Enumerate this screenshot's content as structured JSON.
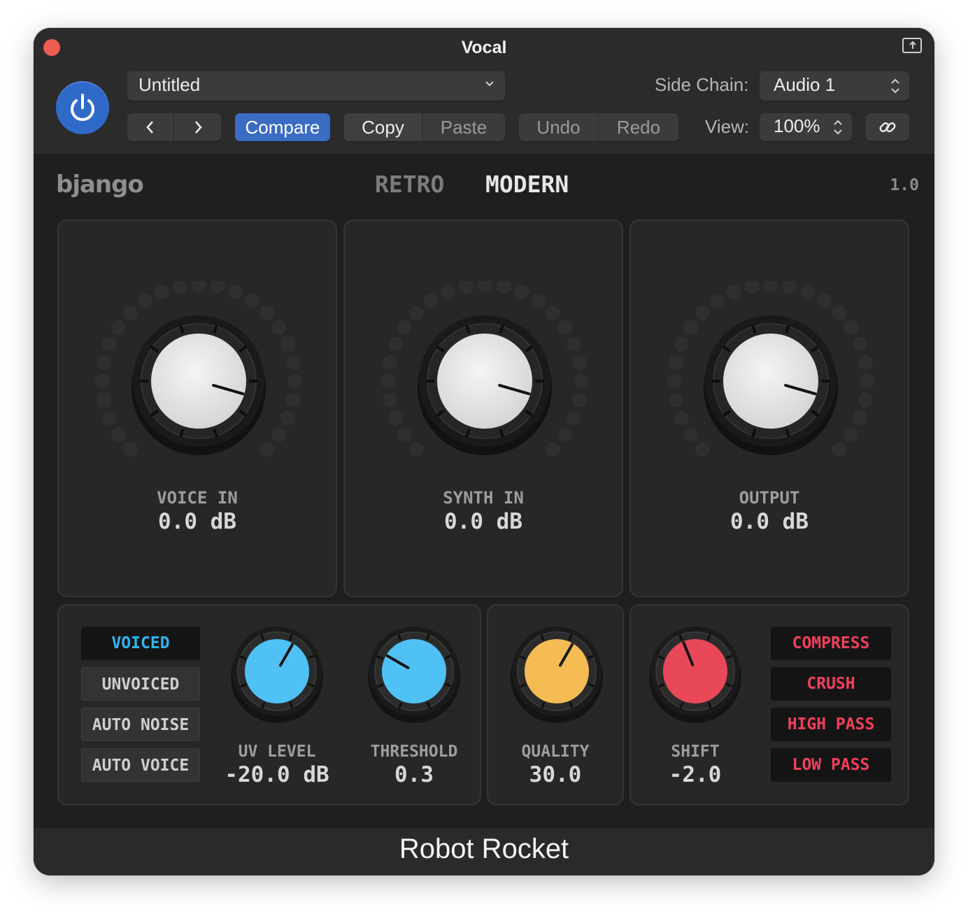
{
  "window": {
    "title": "Vocal"
  },
  "header": {
    "preset": "Untitled",
    "side_chain_label": "Side Chain:",
    "side_chain_value": "Audio 1",
    "compare": "Compare",
    "copy": "Copy",
    "paste": "Paste",
    "undo": "Undo",
    "redo": "Redo",
    "view_label": "View:",
    "view_value": "100%"
  },
  "plugin": {
    "brand": "bjango",
    "modes": [
      "RETRO",
      "MODERN"
    ],
    "active_mode": "MODERN",
    "version": "1.0",
    "main_knobs": [
      {
        "label": "VOICE IN",
        "value": "0.0 dB"
      },
      {
        "label": "SYNTH IN",
        "value": "0.0 dB"
      },
      {
        "label": "OUTPUT",
        "value": "0.0 dB"
      }
    ],
    "mode_buttons": [
      "VOICED",
      "UNVOICED",
      "AUTO NOISE",
      "AUTO VOICE"
    ],
    "active_mode_button": "VOICED",
    "small_knobs": [
      {
        "label": "UV LEVEL",
        "value": "-20.0 dB",
        "color": "#4fc1f5"
      },
      {
        "label": "THRESHOLD",
        "value": "0.3",
        "color": "#4fc1f5"
      },
      {
        "label": "QUALITY",
        "value": "30.0",
        "color": "#f5bc54"
      },
      {
        "label": "SHIFT",
        "value": "-2.0",
        "color": "#e84858"
      }
    ],
    "filter_buttons": [
      "COMPRESS",
      "CRUSH",
      "HIGH PASS",
      "LOW PASS"
    ]
  },
  "footer": {
    "name": "Robot Rocket"
  },
  "colors": {
    "accent_blue": "#3b6cc3",
    "power_blue": "#2f6ac9",
    "voiced_cyan": "#2fb6f0",
    "filter_red": "#f0405a"
  }
}
